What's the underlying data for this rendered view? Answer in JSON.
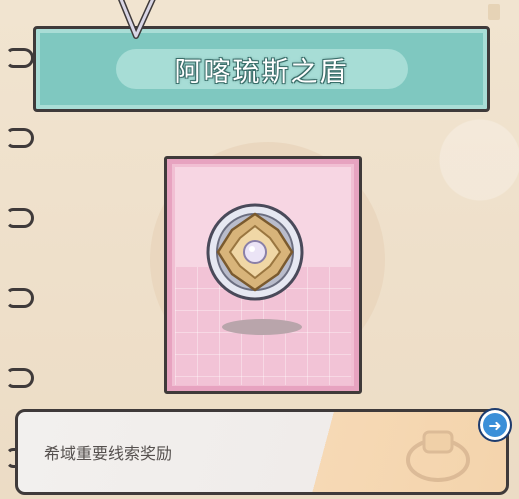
{
  "title": "阿喀琉斯之盾",
  "description": "希域重要线索奖励",
  "icons": {
    "item": "shield-icon",
    "next": "arrow-right-icon",
    "bookmark": "bookmark-icon",
    "ghost": "ring-item-icon"
  },
  "colors": {
    "banner": "#7fc8c0",
    "card": "#f1bfd3",
    "next_button": "#3a8fd8",
    "outline": "#3f3a3a"
  },
  "next_symbol": "➜"
}
